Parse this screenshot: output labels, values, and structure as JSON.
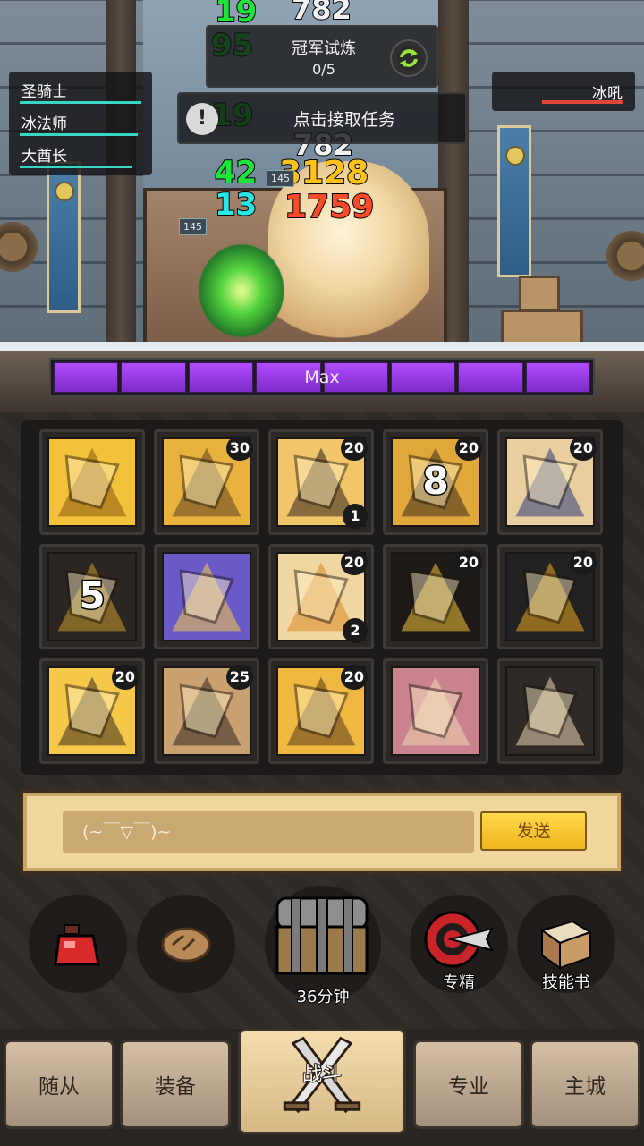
{
  "battle": {
    "party": [
      {
        "name": "圣骑士",
        "hp": 0.85
      },
      {
        "name": "冰法师",
        "hp": 0.82
      },
      {
        "name": "大酋长",
        "hp": 0.78
      }
    ],
    "enemy": {
      "name": "冰吼"
    },
    "trial": {
      "title": "冠军试炼",
      "progress": "0/5",
      "refresh_icon": "refresh-icon"
    },
    "quest": {
      "label": "点击接取任务",
      "alert_glyph": "!"
    },
    "damage_numbers": {
      "g1": "19",
      "g2": "95",
      "g3": "19",
      "g4": "42",
      "c1": "13",
      "w1": "782",
      "y1": "3128",
      "r1": "1759",
      "w2": "782",
      "chip1": "145",
      "chip2": "145"
    },
    "skill_bar": {
      "label": "Max",
      "segments": 8
    }
  },
  "skills": [
    {
      "icon": "holy-sword-icon",
      "count": "",
      "sub": "",
      "big": ""
    },
    {
      "icon": "stained-glass-shatter-icon",
      "count": "30",
      "sub": "",
      "big": ""
    },
    {
      "icon": "horse-head-icon",
      "count": "20",
      "sub": "1",
      "big": ""
    },
    {
      "icon": "sword-strike-icon",
      "count": "20",
      "sub": "",
      "big": "8"
    },
    {
      "icon": "hammer-strike-icon",
      "count": "20",
      "sub": "",
      "big": ""
    },
    {
      "icon": "shield-badge-icon",
      "count": "",
      "sub": "",
      "big": "5"
    },
    {
      "icon": "knight-helmet-icon",
      "count": "",
      "sub": "",
      "big": ""
    },
    {
      "icon": "cross-burst-icon",
      "count": "20",
      "sub": "2",
      "big": ""
    },
    {
      "icon": "dagger-swirl-icon",
      "count": "20",
      "sub": "",
      "big": ""
    },
    {
      "icon": "lightning-hammer-icon",
      "count": "20",
      "sub": "",
      "big": ""
    },
    {
      "icon": "golden-crown-icon",
      "count": "20",
      "sub": "",
      "big": ""
    },
    {
      "icon": "war-hammer-icon",
      "count": "25",
      "sub": "",
      "big": ""
    },
    {
      "icon": "mallet-icon",
      "count": "20",
      "sub": "",
      "big": ""
    },
    {
      "icon": "pink-hammer-icon",
      "count": "",
      "sub": "",
      "big": ""
    },
    {
      "icon": "open-hand-icon",
      "count": "",
      "sub": "",
      "big": ""
    }
  ],
  "chat": {
    "value": "(~￣▽￣)~",
    "send_label": "发送"
  },
  "actions": {
    "potion_icon": "potion-icon",
    "bread_icon": "bread-icon",
    "chest_label": "36分钟",
    "mastery_label": "专精",
    "skillbook_label": "技能书"
  },
  "nav": {
    "tabs": [
      "随从",
      "装备",
      "战斗",
      "专业",
      "主城"
    ],
    "active": "战斗"
  },
  "colors": {
    "skill_bar": "#9b3ee8",
    "hp_bar": "#39d6c3",
    "enemy_hp": "#e0483a",
    "send_button": "#ffd94a"
  }
}
